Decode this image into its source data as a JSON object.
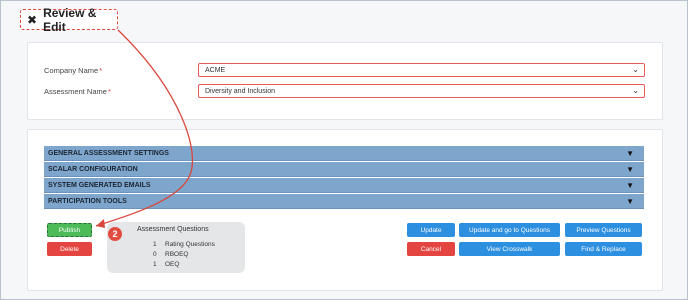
{
  "page": {
    "title": "Review & Edit",
    "title_icon": "tools-icon"
  },
  "form": {
    "company": {
      "label": "Company Name",
      "required_mark": "*",
      "value": "ACME"
    },
    "assessment": {
      "label": "Assessment Name",
      "required_mark": "*",
      "value": "Diversity and Inclusion"
    }
  },
  "accordion": [
    {
      "label": "GENERAL ASSESSMENT SETTINGS"
    },
    {
      "label": "SCALAR CONFIGURATION"
    },
    {
      "label": "SYSTEM GENERATED EMAILS"
    },
    {
      "label": "PARTICIPATION TOOLS"
    }
  ],
  "buttons": {
    "publish": "Publish",
    "delete": "Delete",
    "update": "Update",
    "update_go": "Update and go to Questions",
    "preview": "Preview Questions",
    "cancel": "Cancel",
    "crosswalk": "View Crosswalk",
    "find_replace": "Find & Replace"
  },
  "assessment_questions": {
    "title": "Assessment Questions",
    "rows": [
      {
        "count": "1",
        "label": "Rating Questions"
      },
      {
        "count": "0",
        "label": "RBOEQ"
      },
      {
        "count": "1",
        "label": "OEQ"
      }
    ]
  },
  "annotation": {
    "step": "2"
  },
  "colors": {
    "accent_blue": "#2d8fe0",
    "danger_red": "#e54540",
    "success_green": "#4dbb57",
    "accordion": "#7ea6cc",
    "annotation_red": "#e24b3f"
  }
}
